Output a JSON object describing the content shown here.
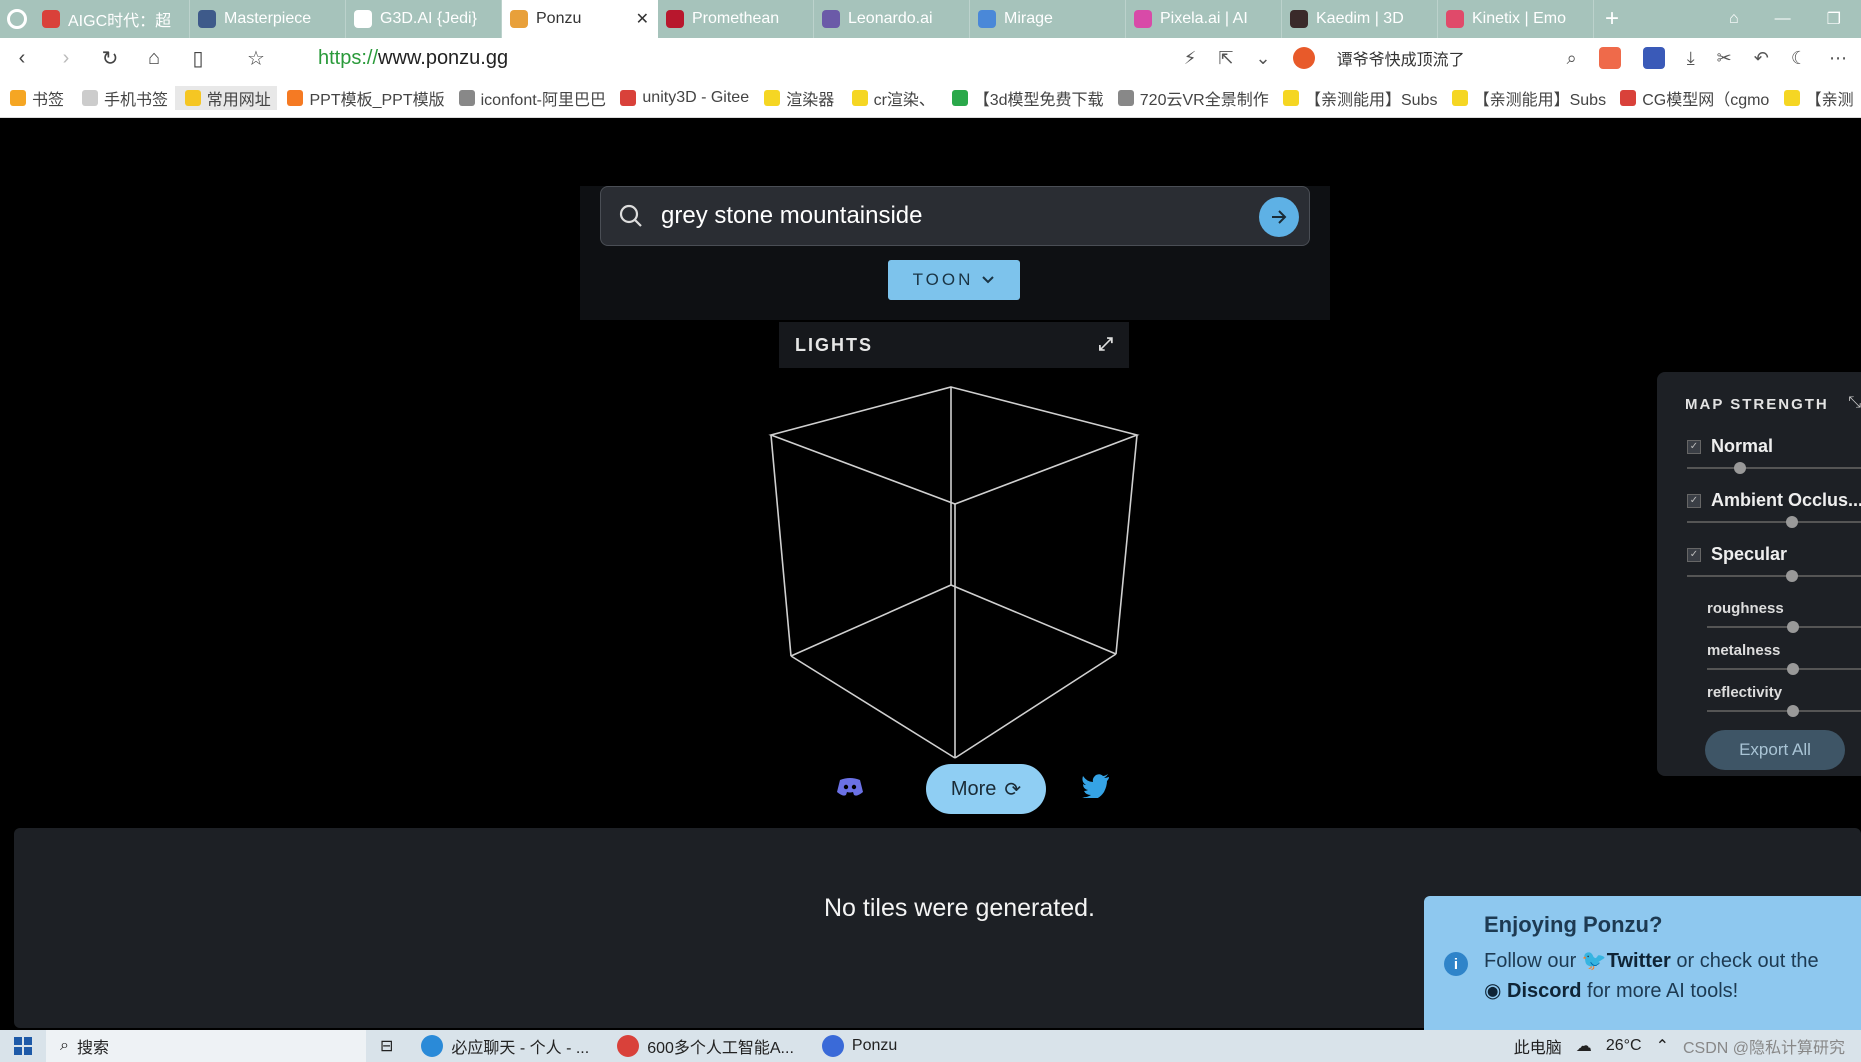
{
  "browser": {
    "tabs": [
      {
        "label": "AIGC时代：超",
        "color": "#d9413a"
      },
      {
        "label": "Masterpiece",
        "color": "#3e5a8a"
      },
      {
        "label": "G3D.AI {Jedi}",
        "color": "#ffffff"
      },
      {
        "label": "Ponzu",
        "color": "#e8a03a",
        "active": true
      },
      {
        "label": "Promethean",
        "color": "#b8172d"
      },
      {
        "label": "Leonardo.ai",
        "color": "#6b5aa8"
      },
      {
        "label": "Mirage",
        "color": "#4a88d8"
      },
      {
        "label": "Pixela.ai | AI",
        "color": "#d84aa8"
      },
      {
        "label": "Kaedim | 3D",
        "color": "#3a2a2a"
      },
      {
        "label": "Kinetix | Emo",
        "color": "#e04a6a"
      }
    ],
    "close_glyph": "✕",
    "plus_glyph": "+",
    "url_scheme": "https://",
    "url_rest": "www.ponzu.gg",
    "hot_search": "谭爷爷快成顶流了",
    "bookmarks": [
      {
        "label": "书签",
        "color": "#f5a623"
      },
      {
        "label": "手机书签",
        "color": "#cccccc"
      },
      {
        "label": "常用网址",
        "color": "#f5c623",
        "selected": true
      },
      {
        "label": "PPT模板_PPT模版",
        "color": "#f57a23"
      },
      {
        "label": "iconfont-阿里巴巴",
        "color": "#888888"
      },
      {
        "label": "unity3D - Gitee",
        "color": "#d9413a"
      },
      {
        "label": "渲染器",
        "color": "#f5d623"
      },
      {
        "label": "cr渲染、",
        "color": "#f5d623"
      },
      {
        "label": "【3d模型免费下载",
        "color": "#2aa84a"
      },
      {
        "label": "720云VR全景制作",
        "color": "#888888"
      },
      {
        "label": "【亲测能用】Subs",
        "color": "#f5d623"
      },
      {
        "label": "【亲测能用】Subs",
        "color": "#f5d623"
      },
      {
        "label": "CG模型网（cgmo",
        "color": "#d9413a"
      },
      {
        "label": "【亲测",
        "color": "#f5d623"
      }
    ]
  },
  "page": {
    "search": {
      "query": "grey stone mountainside"
    },
    "style_button": "TOON",
    "lights_title": "LIGHTS",
    "more_button": "More",
    "tiles_message": "No tiles were generated.",
    "map_panel": {
      "title": "MAP STRENGTH",
      "normal": {
        "label": "Normal",
        "checked": true,
        "value": 0.27
      },
      "ao": {
        "label": "Ambient Occlus...",
        "checked": true,
        "value": 0.57
      },
      "specular": {
        "label": "Specular",
        "checked": true,
        "value": 0.57
      },
      "roughness": {
        "label": "roughness",
        "value": 0.52
      },
      "metalness": {
        "label": "metalness",
        "value": 0.52
      },
      "reflectivity": {
        "label": "reflectivity",
        "value": 0.52
      },
      "export_button": "Export All"
    },
    "toast": {
      "title": "Enjoying Ponzu?",
      "line1_prefix": "Follow our",
      "twitter": "Twitter",
      "line1_suffix": "or check out the",
      "discord": "Discord",
      "line2_suffix": "for more AI tools!"
    }
  },
  "taskbar": {
    "search_label": "搜索",
    "items": [
      {
        "label": "必应聊天 - 个人 - ...",
        "color": "#2a8ad8"
      },
      {
        "label": "600多个人工智能A...",
        "color": "#d9413a"
      },
      {
        "label": "Ponzu",
        "color": "#3a6ad8"
      }
    ],
    "this_pc": "此电脑",
    "temperature": "26°C",
    "watermark": "CSDN @隐私计算研究"
  }
}
